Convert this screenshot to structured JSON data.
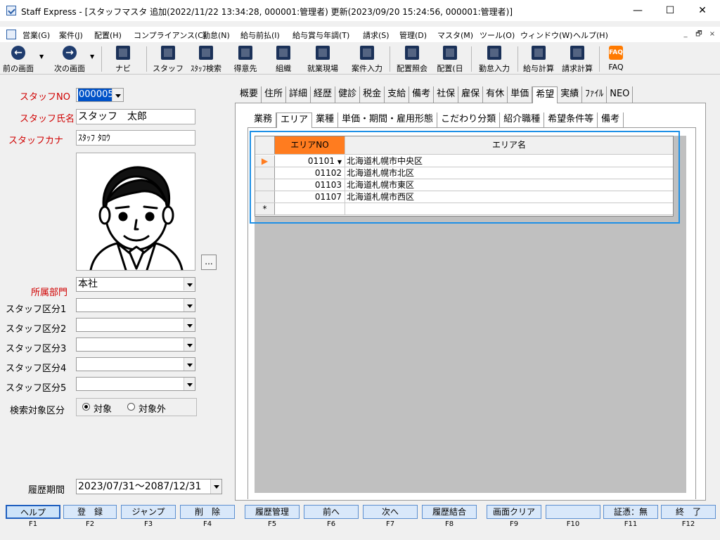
{
  "window": {
    "title": "Staff Express - [スタッフマスタ 追加(2022/11/22 13:34:28, 000001:管理者) 更新(2023/09/20 15:24:56, 000001:管理者)]",
    "min": "—",
    "max": "☐",
    "close": "✕"
  },
  "menu": [
    "営業(G)",
    "案件(J)",
    "配置(H)",
    "コンプライアンス(C)",
    "勤怠(N)",
    "給与前払(I)",
    "給与賞与年調(T)",
    "請求(S)",
    "管理(D)",
    "マスタ(M)",
    "ツール(O)",
    "ウィンドウ(W)",
    "ヘルプ(H)"
  ],
  "mdi": [
    "_",
    "🗗",
    "×"
  ],
  "toolbar": [
    {
      "label": "前の画面",
      "icon": "left-arrow-icon"
    },
    {
      "label": "次の画面",
      "icon": "right-arrow-icon"
    },
    {
      "label": "ナビ",
      "icon": "navi-icon"
    },
    {
      "label": "スタッフ",
      "icon": "staff-icon"
    },
    {
      "label": "ｽﾀｯﾌ検索",
      "icon": "staff-search-icon"
    },
    {
      "label": "得意先",
      "icon": "client-icon"
    },
    {
      "label": "組織",
      "icon": "org-icon"
    },
    {
      "label": "就業現場",
      "icon": "worksite-icon"
    },
    {
      "label": "案件入力",
      "icon": "case-input-icon"
    },
    {
      "label": "配置照会",
      "icon": "assign-query-icon"
    },
    {
      "label": "配置(日",
      "icon": "assign-daily-icon"
    },
    {
      "label": "勤怠入力",
      "icon": "attendance-icon"
    },
    {
      "label": "給与計算",
      "icon": "payroll-icon"
    },
    {
      "label": "請求計算",
      "icon": "billing-icon"
    },
    {
      "label": "FAQ",
      "icon": "faq-icon"
    }
  ],
  "form": {
    "staff_no_label": "スタッフNO",
    "staff_no": "000005",
    "name_label": "スタッフ氏名",
    "name": "スタッフ　太郎",
    "kana_label": "スタッフカナ",
    "kana": "ｽﾀｯﾌ ﾀﾛｳ",
    "photo_btn": "...",
    "dept_label": "所属部門",
    "dept": "本社",
    "kubun_labels": [
      "スタッフ区分1",
      "スタッフ区分2",
      "スタッフ区分3",
      "スタッフ区分4",
      "スタッフ区分5"
    ],
    "search_label": "検索対象区分",
    "radio_on": "対象",
    "radio_off": "対象外",
    "period_label": "履歴期間",
    "period": "2023/07/31〜2087/12/31"
  },
  "tabs1": [
    "概要",
    "住所",
    "詳細",
    "経歴",
    "健診",
    "税金",
    "支給",
    "備考",
    "社保",
    "雇保",
    "有休",
    "単価",
    "希望",
    "実績",
    "ﾌｧｲﾙ",
    "NEO"
  ],
  "tabs2": [
    "業務",
    "エリア",
    "業種",
    "単価・期間・雇用形態",
    "こだわり分類",
    "紹介職種",
    "希望条件等",
    "備考"
  ],
  "grid": {
    "col_no": "エリアNO",
    "col_name": "エリア名",
    "rows": [
      {
        "no": "01101",
        "name": "北海道札幌市中央区"
      },
      {
        "no": "01102",
        "name": "北海道札幌市北区"
      },
      {
        "no": "01103",
        "name": "北海道札幌市東区"
      },
      {
        "no": "01107",
        "name": "北海道札幌市西区"
      }
    ],
    "new_mark": "*"
  },
  "fkeys": [
    {
      "label": "ヘルプ",
      "key": "F1"
    },
    {
      "label": "登　録",
      "key": "F2"
    },
    {
      "label": "ジャンプ",
      "key": "F3"
    },
    {
      "label": "削　除",
      "key": "F4"
    },
    {
      "label": "履歴管理",
      "key": "F5"
    },
    {
      "label": "前へ",
      "key": "F6"
    },
    {
      "label": "次へ",
      "key": "F7"
    },
    {
      "label": "履歴結合",
      "key": "F8"
    },
    {
      "label": "画面クリア",
      "key": "F9"
    },
    {
      "label": "",
      "key": "F10"
    },
    {
      "label": "証憑：無",
      "key": "F11"
    },
    {
      "label": "終　了",
      "key": "F12"
    }
  ]
}
